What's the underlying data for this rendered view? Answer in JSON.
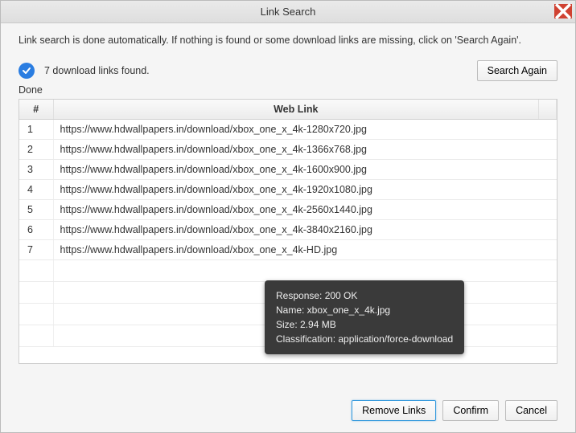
{
  "window": {
    "title": "Link Search"
  },
  "instructions": "Link search is done automatically. If nothing is found or some download links are missing, click on 'Search Again'.",
  "status": {
    "found_text": "7 download links found.",
    "done_text": "Done",
    "search_again_label": "Search Again"
  },
  "table": {
    "headers": {
      "num": "#",
      "link": "Web Link"
    },
    "rows": [
      {
        "n": "1",
        "url": "https://www.hdwallpapers.in/download/xbox_one_x_4k-1280x720.jpg"
      },
      {
        "n": "2",
        "url": "https://www.hdwallpapers.in/download/xbox_one_x_4k-1366x768.jpg"
      },
      {
        "n": "3",
        "url": "https://www.hdwallpapers.in/download/xbox_one_x_4k-1600x900.jpg"
      },
      {
        "n": "4",
        "url": "https://www.hdwallpapers.in/download/xbox_one_x_4k-1920x1080.jpg"
      },
      {
        "n": "5",
        "url": "https://www.hdwallpapers.in/download/xbox_one_x_4k-2560x1440.jpg"
      },
      {
        "n": "6",
        "url": "https://www.hdwallpapers.in/download/xbox_one_x_4k-3840x2160.jpg"
      },
      {
        "n": "7",
        "url": "https://www.hdwallpapers.in/download/xbox_one_x_4k-HD.jpg"
      }
    ]
  },
  "tooltip": {
    "response": "Response: 200 OK",
    "name": "Name: xbox_one_x_4k.jpg",
    "size": "Size: 2.94 MB",
    "classification": "Classification: application/force-download"
  },
  "footer": {
    "remove_label": "Remove Links",
    "confirm_label": "Confirm",
    "cancel_label": "Cancel"
  }
}
